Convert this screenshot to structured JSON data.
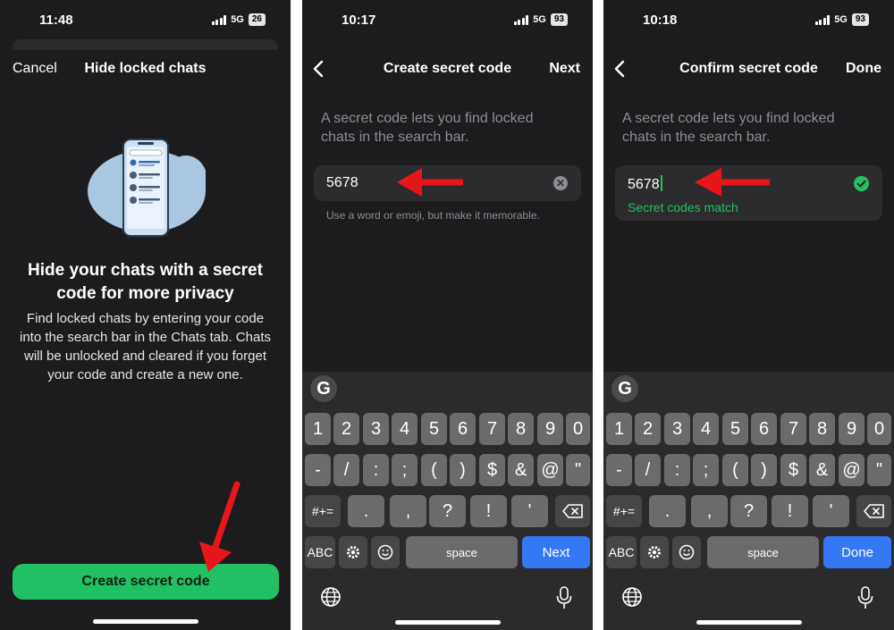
{
  "colors": {
    "accent_green": "#21c063",
    "action_blue": "#3478f6",
    "arrow_red": "#e8161b",
    "panel_bg": "#1c1c1e"
  },
  "screens": [
    {
      "status": {
        "time": "11:48",
        "network": "5G",
        "battery": "26"
      },
      "nav": {
        "left": "Cancel",
        "title": "Hide locked chats"
      },
      "heading": "Hide your chats with a secret code for more privacy",
      "body": "Find locked chats by entering your code into the search bar in the Chats tab. Chats will be unlocked and cleared if you forget your code and create a new one.",
      "button": "Create secret code",
      "illustration_icon": "phone-chat-list-icon"
    },
    {
      "status": {
        "time": "10:17",
        "network": "5G",
        "battery": "93"
      },
      "nav": {
        "title": "Create secret code",
        "right": "Next"
      },
      "description": "A secret code lets you find locked chats in the search bar.",
      "field_value": "5678",
      "hint": "Use a word or emoji, but make it memorable.",
      "keyboard_action": "Next"
    },
    {
      "status": {
        "time": "10:18",
        "network": "5G",
        "battery": "93"
      },
      "nav": {
        "title": "Confirm secret code",
        "right": "Done"
      },
      "description": "A secret code lets you find locked chats in the search bar.",
      "field_value": "5678",
      "match_text": "Secret codes match",
      "keyboard_action": "Done"
    }
  ],
  "keyboard": {
    "google_icon": "G",
    "row1": [
      "1",
      "2",
      "3",
      "4",
      "5",
      "6",
      "7",
      "8",
      "9",
      "0"
    ],
    "row2": [
      "-",
      "/",
      ":",
      ";",
      "(",
      ")",
      "$",
      "&",
      "@",
      "\""
    ],
    "row3": [
      ".",
      ",",
      "?",
      "!",
      "'"
    ],
    "symbols_key": "#+=",
    "abc_key": "ABC",
    "space_key": "space"
  }
}
